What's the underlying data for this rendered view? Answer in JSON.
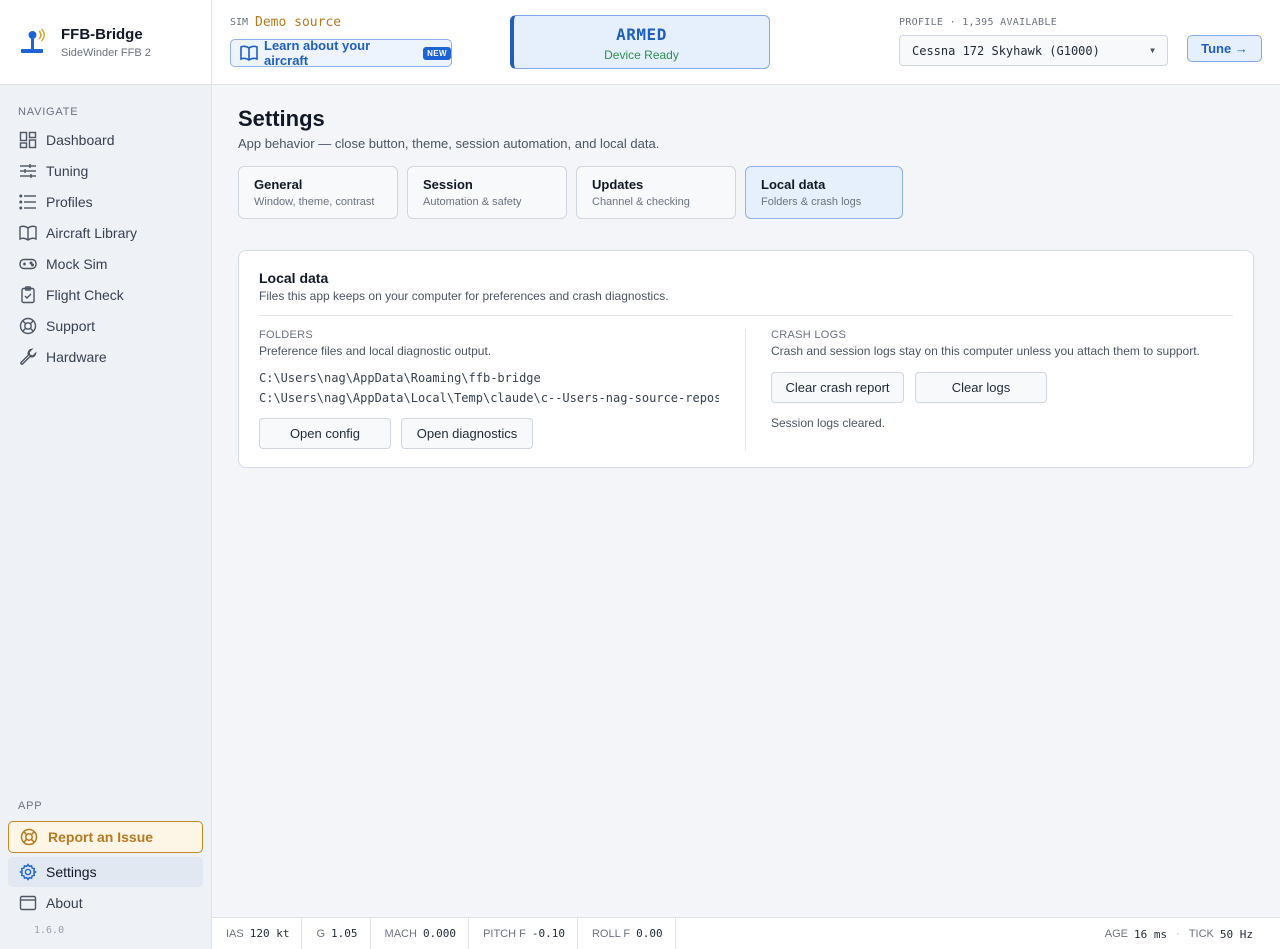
{
  "app": {
    "name": "FFB-Bridge",
    "device": "SideWinder FFB 2",
    "version": "1.6.0"
  },
  "sidebar": {
    "nav_heading": "NAVIGATE",
    "nav_items": [
      {
        "label": "Dashboard",
        "icon": "dashboard-icon"
      },
      {
        "label": "Tuning",
        "icon": "sliders-icon"
      },
      {
        "label": "Profiles",
        "icon": "list-icon"
      },
      {
        "label": "Aircraft Library",
        "icon": "book-icon"
      },
      {
        "label": "Mock Sim",
        "icon": "gamepad-icon"
      },
      {
        "label": "Flight Check",
        "icon": "clipboard-check-icon"
      },
      {
        "label": "Support",
        "icon": "lifebuoy-icon"
      },
      {
        "label": "Hardware",
        "icon": "wrench-icon"
      }
    ],
    "app_heading": "APP",
    "report_issue": "Report an Issue",
    "settings": "Settings",
    "about": "About"
  },
  "topbar": {
    "sim_label": "SIM",
    "sim_source": "Demo source",
    "learn_label": "Learn about your aircraft",
    "new_badge": "NEW",
    "status_title": "ARMED",
    "status_sub": "Device Ready",
    "profile_label": "PROFILE · 1,395 AVAILABLE",
    "profile_value": "Cessna 172 Skyhawk (G1000)",
    "tune_label": "Tune →"
  },
  "page": {
    "title": "Settings",
    "subtitle": "App behavior — close button, theme, session automation, and local data.",
    "tabs": [
      {
        "label": "General",
        "sub": "Window, theme, contrast"
      },
      {
        "label": "Session",
        "sub": "Automation & safety"
      },
      {
        "label": "Updates",
        "sub": "Channel & checking"
      },
      {
        "label": "Local data",
        "sub": "Folders & crash logs"
      }
    ],
    "active_tab": "Local data"
  },
  "local_data": {
    "title": "Local data",
    "subtitle": "Files this app keeps on your computer for preferences and crash diagnostics.",
    "folders": {
      "label": "FOLDERS",
      "desc": "Preference files and local diagnostic output.",
      "paths": [
        "C:\\Users\\nag\\AppData\\Roaming\\ffb-bridge",
        "C:\\Users\\nag\\AppData\\Local\\Temp\\claude\\c--Users-nag-source-repos-…"
      ],
      "open_config": "Open config",
      "open_diagnostics": "Open diagnostics"
    },
    "crash_logs": {
      "label": "CRASH LOGS",
      "desc": "Crash and session logs stay on this computer unless you attach them to support.",
      "clear_crash": "Clear crash report",
      "clear_logs": "Clear logs",
      "status": "Session logs cleared."
    }
  },
  "statusbar": {
    "ias_label": "IAS",
    "ias_value": "120 kt",
    "g_label": "G",
    "g_value": "1.05",
    "mach_label": "MACH",
    "mach_value": "0.000",
    "pitch_label": "PITCH F",
    "pitch_value": "-0.10",
    "roll_label": "ROLL F",
    "roll_value": "0.00",
    "age_label": "AGE",
    "age_value": "16 ms",
    "tick_label": "TICK",
    "tick_value": "50 Hz"
  },
  "colors": {
    "accent": "#1f5fbf",
    "warning": "#b7791f",
    "success": "#2f8f4e"
  }
}
